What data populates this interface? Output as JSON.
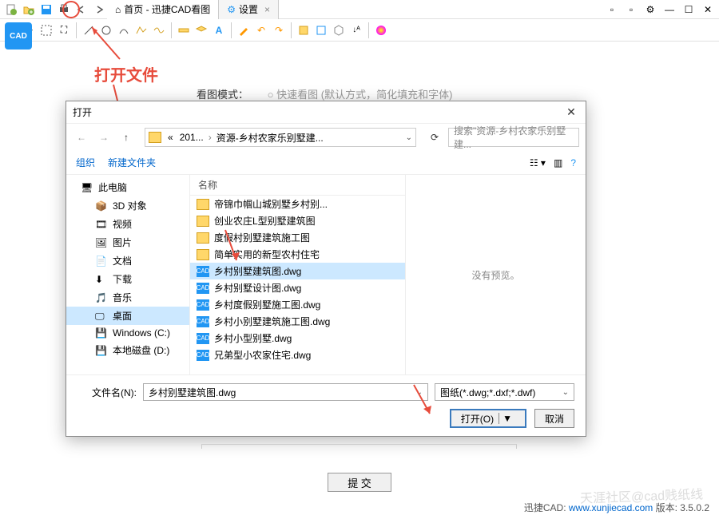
{
  "titlebar": {
    "tabs": [
      {
        "label": "首页 - 迅捷CAD看图"
      },
      {
        "label": "设置"
      }
    ]
  },
  "annotation": {
    "open_file": "打开文件"
  },
  "view_mode": {
    "label": "看图模式：",
    "option": "快速看图 (默认方式，简化填充和字体)"
  },
  "submit": {
    "label": "提 交"
  },
  "footer": {
    "app": "迅捷CAD:",
    "url": "www.xunjiecad.com",
    "version_label": "版本:",
    "version": "3.5.0.2"
  },
  "watermark": "天涯社区@cad贱纸线",
  "dialog": {
    "title": "打开",
    "breadcrumb": [
      "201...",
      "资源-乡村农家乐别墅建..."
    ],
    "search_placeholder": "搜索\"资源-乡村农家乐别墅建...",
    "organize": "组织",
    "new_folder": "新建文件夹",
    "column_name": "名称",
    "tree": [
      {
        "label": "此电脑",
        "icon": "pc",
        "level": 1
      },
      {
        "label": "3D 对象",
        "icon": "3d",
        "level": 2
      },
      {
        "label": "视频",
        "icon": "video",
        "level": 2
      },
      {
        "label": "图片",
        "icon": "image",
        "level": 2
      },
      {
        "label": "文档",
        "icon": "doc",
        "level": 2
      },
      {
        "label": "下载",
        "icon": "download",
        "level": 2
      },
      {
        "label": "音乐",
        "icon": "music",
        "level": 2
      },
      {
        "label": "桌面",
        "icon": "desktop",
        "level": 2,
        "selected": true
      },
      {
        "label": "Windows (C:)",
        "icon": "drive",
        "level": 2
      },
      {
        "label": "本地磁盘 (D:)",
        "icon": "drive",
        "level": 2
      }
    ],
    "files": [
      {
        "name": "帝锦巾帼山城别墅乡村别...",
        "type": "folder"
      },
      {
        "name": "创业农庄L型别墅建筑图",
        "type": "folder"
      },
      {
        "name": "度假村别墅建筑施工图",
        "type": "folder"
      },
      {
        "name": "简单实用的新型农村住宅",
        "type": "folder"
      },
      {
        "name": "乡村别墅建筑图.dwg",
        "type": "cad",
        "selected": true
      },
      {
        "name": "乡村别墅设计图.dwg",
        "type": "cad"
      },
      {
        "name": "乡村度假别墅施工图.dwg",
        "type": "cad"
      },
      {
        "name": "乡村小别墅建筑施工图.dwg",
        "type": "cad"
      },
      {
        "name": "乡村小型别墅.dwg",
        "type": "cad"
      },
      {
        "name": "兄弟型小农家住宅.dwg",
        "type": "cad"
      }
    ],
    "preview_text": "没有预览。",
    "filename_label": "文件名(N):",
    "filename_value": "乡村别墅建筑图.dwg",
    "filetype_value": "图纸(*.dwg;*.dxf;*.dwf)",
    "open_btn": "打开(O)",
    "cancel_btn": "取消"
  }
}
